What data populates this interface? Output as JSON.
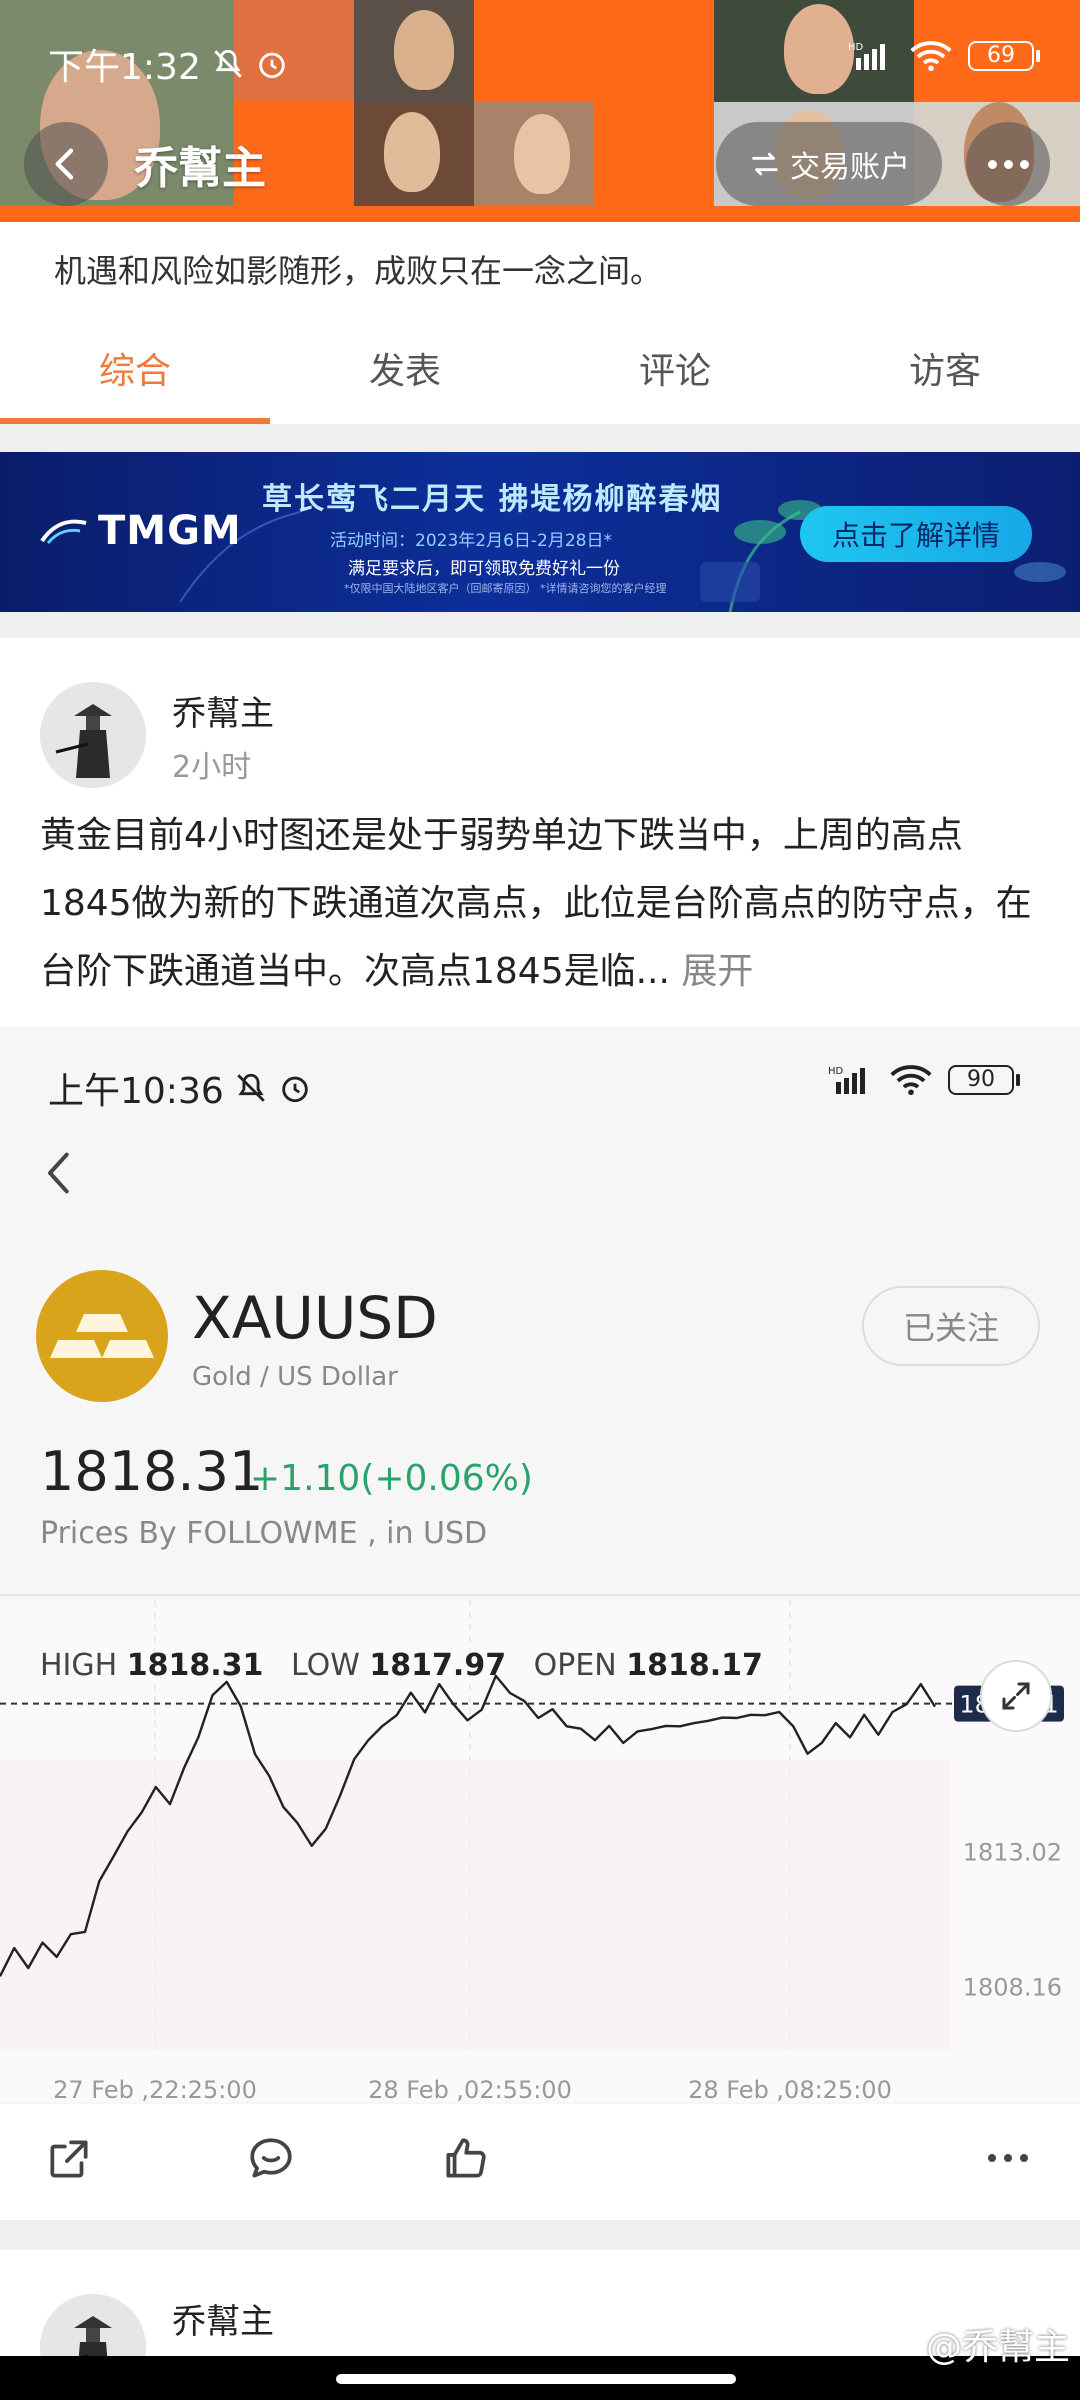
{
  "status_bar": {
    "time": "下午1:32",
    "battery": "69",
    "network": "HD"
  },
  "nav": {
    "title": "乔幫主",
    "trade_account": "交易账户"
  },
  "profile": {
    "bio": "机遇和风险如影随形，成败只在一念之间。"
  },
  "tabs": [
    {
      "label": "综合",
      "active": true
    },
    {
      "label": "发表",
      "active": false
    },
    {
      "label": "评论",
      "active": false
    },
    {
      "label": "访客",
      "active": false
    }
  ],
  "banner": {
    "brand": "TMGM",
    "title": "草长莺飞二月天  拂堤杨柳醉春烟",
    "date": "活动时间：2023年2月6日-2月28日*",
    "sub": "满足要求后，即可领取免费好礼一份",
    "small": "*仅限中国大陆地区客户（回邮寄原因） *详情请咨询您的客户经理",
    "cta": "点击了解详情"
  },
  "post": {
    "author": "乔幫主",
    "time": "2小时",
    "text": "黄金目前4小时图还是处于弱势单边下跌当中，上周的高点1845做为新的下跌通道次高点，此位是台阶高点的防守点，在台阶下跌通道当中。次高点1845是临...",
    "expand": "展开"
  },
  "embed": {
    "status_time": "上午10:36",
    "battery": "90",
    "network": "HD",
    "symbol": "XAUUSD",
    "symbol_desc": "Gold / US Dollar",
    "follow": "已关注",
    "price": "1818.31",
    "change": "+1.10(+0.06%)",
    "source": "Prices By FOLLOWME , in USD",
    "high_label": "HIGH",
    "high": "1818.31",
    "low_label": "LOW",
    "low": "1817.97",
    "open_label": "OPEN",
    "open": "1818.17"
  },
  "chart_data": {
    "type": "line",
    "x_ticks": [
      "27 Feb ,22:25:00",
      "28 Feb ,02:55:00",
      "28 Feb ,08:25:00"
    ],
    "y_ticks": [
      "1813.02",
      "1808.16"
    ],
    "current_label": "1818.31",
    "current_value": 1818.31,
    "ylim": [
      1806.2,
      1820.6
    ],
    "series": [
      {
        "values": [
          1808.6,
          1809.4,
          1808.9,
          1809.6,
          1809.3,
          1809.9,
          1810.2,
          1811.8,
          1812.9,
          1813.6,
          1814.5,
          1815.2,
          1814.8,
          1815.9,
          1817.2,
          1818.5,
          1819.2,
          1818.1,
          1816.6,
          1815.6,
          1814.7,
          1813.9,
          1813.3,
          1813.7,
          1815.1,
          1816.2,
          1817.1,
          1817.4,
          1818.0,
          1818.6,
          1818.1,
          1818.9,
          1818.4,
          1817.6,
          1818.2,
          1819.2,
          1818.8,
          1818.3,
          1817.9,
          1818.0,
          1817.6,
          1817.3,
          1817.1,
          1817.4,
          1817.0,
          1817.2,
          1817.5,
          1817.4,
          1817.6,
          1817.5,
          1817.8,
          1817.7,
          1817.9,
          1817.8,
          1818.0,
          1817.9,
          1817.6,
          1816.4,
          1817.0,
          1817.5,
          1817.2,
          1817.8,
          1817.3,
          1817.9,
          1818.4,
          1818.9,
          1818.31
        ]
      }
    ]
  },
  "actions": [
    "share",
    "comment",
    "like",
    "more"
  ],
  "next_post": {
    "author": "乔幫主"
  },
  "watermark": "@乔幫主",
  "colors": {
    "accent": "#f07a3a",
    "positive": "#2aa36b",
    "gold": "#d9a41c"
  }
}
